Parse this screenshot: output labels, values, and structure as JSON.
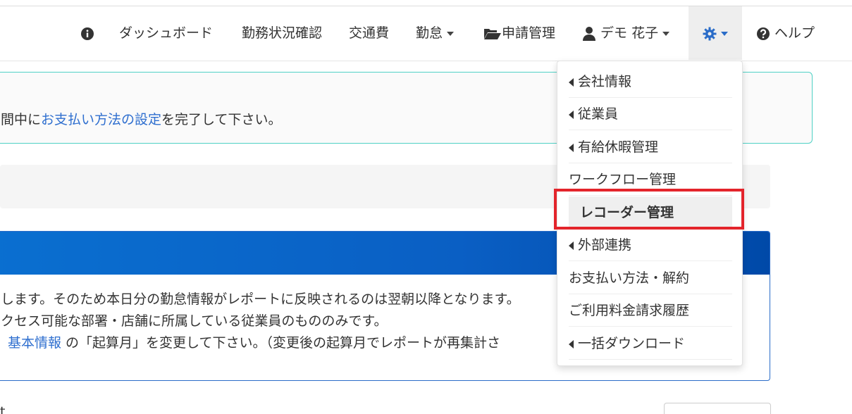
{
  "navbar": {
    "items": [
      {
        "label": "ダッシュボード"
      },
      {
        "label": "勤務状況確認"
      },
      {
        "label": "交通費"
      },
      {
        "label": "勤怠"
      },
      {
        "label": "申請管理"
      },
      {
        "label": "デモ 花子"
      },
      {
        "label": "ヘルプ"
      }
    ]
  },
  "alert": {
    "prefix": "間中に",
    "link": "お支払い方法の設定",
    "suffix": "を完了して下さい。"
  },
  "panel": {
    "line1": "します。そのため本日分の勤怠情報がレポートに反映されるのは翌朝以降となります。",
    "line2": "クセス可能な部署・店舗に所属している従業員のもののみです。",
    "line3_link": "基本情報",
    "line3_text": " の「起算月」を変更して下さい。（変更後の起算月でレポートが再集計さ"
  },
  "dropdown": {
    "items": [
      {
        "label": "会社情報"
      },
      {
        "label": "従業員"
      },
      {
        "label": "有給休暇管理"
      },
      {
        "label": "ワークフロー管理"
      },
      {
        "label": "レコーダー管理"
      },
      {
        "label": "外部連携"
      },
      {
        "label": "お支払い方法・解約"
      },
      {
        "label": "ご利用料金請求履歴"
      },
      {
        "label": "一括ダウンロード"
      }
    ]
  },
  "bottom": {
    "left_text": "t"
  },
  "colors": {
    "accent": "#2a6cc8",
    "link": "#2f6fcf",
    "alert_border": "#4fd1c5",
    "highlight": "#e3242b"
  }
}
